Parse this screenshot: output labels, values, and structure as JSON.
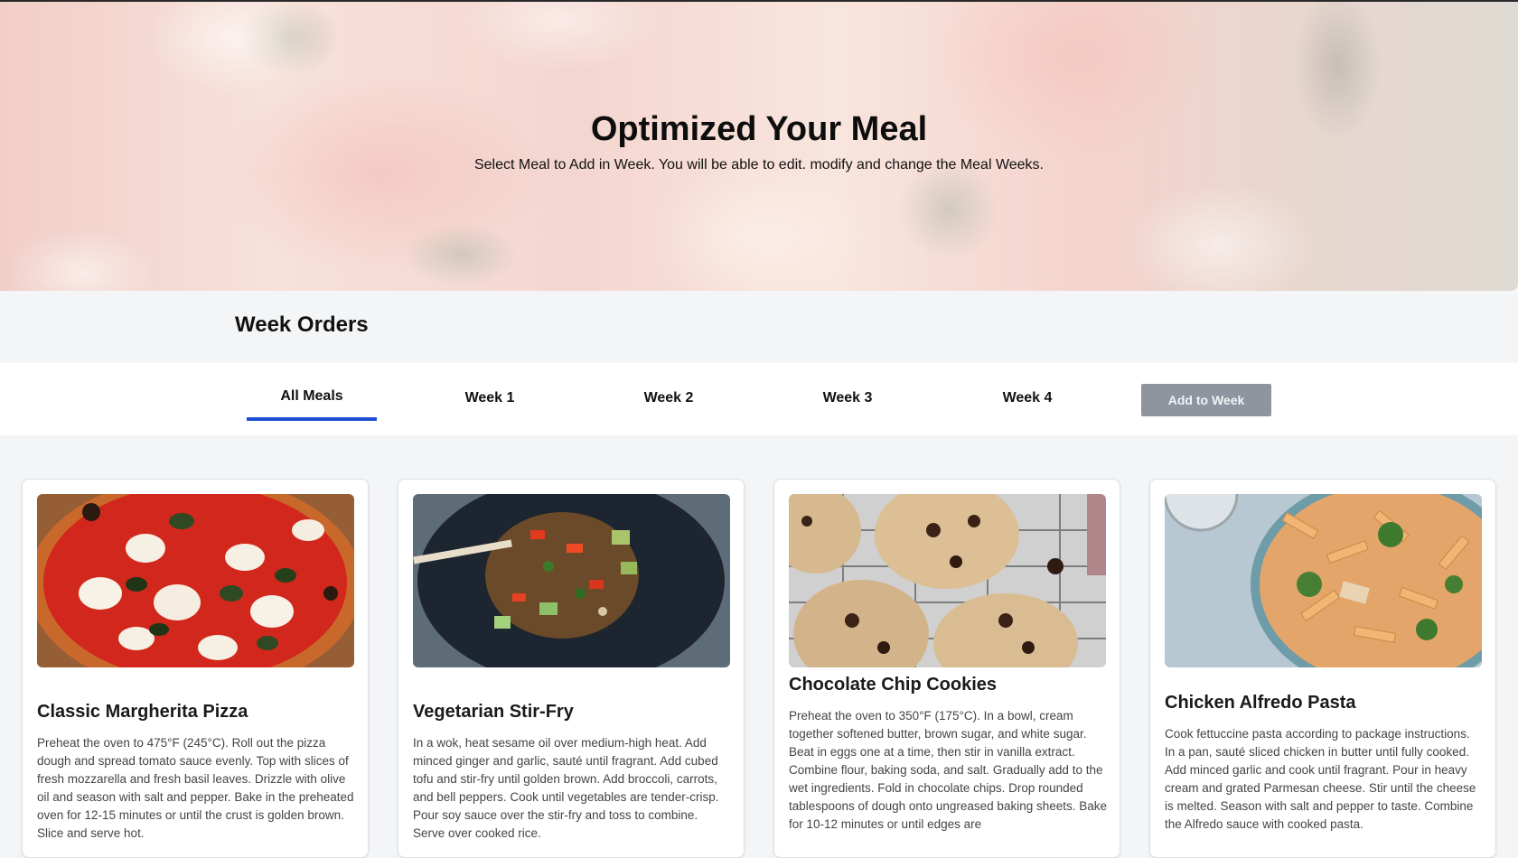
{
  "hero": {
    "title": "Optimized Your Meal",
    "subtitle": "Select Meal to Add in Week. You will be able to edit. modify and change the Meal Weeks."
  },
  "week_orders": {
    "title": "Week Orders"
  },
  "tabs": [
    {
      "label": "All Meals",
      "active": true
    },
    {
      "label": "Week 1",
      "active": false
    },
    {
      "label": "Week 2",
      "active": false
    },
    {
      "label": "Week 3",
      "active": false
    },
    {
      "label": "Week 4",
      "active": false
    }
  ],
  "add_to_week_label": "Add to Week",
  "colors": {
    "accent": "#1f4fd1",
    "button_disabled": "#8e959f"
  },
  "meals": [
    {
      "title": "Classic Margherita Pizza",
      "description": "Preheat the oven to 475°F (245°C). Roll out the pizza dough and spread tomato sauce evenly. Top with slices of fresh mozzarella and fresh basil leaves. Drizzle with olive oil and season with salt and pepper. Bake in the preheated oven for 12-15 minutes or until the crust is golden brown. Slice and serve hot.",
      "image": "margherita-pizza-photo"
    },
    {
      "title": "Vegetarian Stir-Fry",
      "description": "In a wok, heat sesame oil over medium-high heat. Add minced ginger and garlic, sauté until fragrant. Add cubed tofu and stir-fry until golden brown. Add broccoli, carrots, and bell peppers. Cook until vegetables are tender-crisp. Pour soy sauce over the stir-fry and toss to combine. Serve over cooked rice.",
      "image": "stir-fry-photo"
    },
    {
      "title": "Chocolate Chip Cookies",
      "description": "Preheat the oven to 350°F (175°C). In a bowl, cream together softened butter, brown sugar, and white sugar. Beat in eggs one at a time, then stir in vanilla extract. Combine flour, baking soda, and salt. Gradually add to the wet ingredients. Fold in chocolate chips. Drop rounded tablespoons of dough onto ungreased baking sheets. Bake for 10-12 minutes or until edges are",
      "image": "chocolate-chip-cookies-photo"
    },
    {
      "title": "Chicken Alfredo Pasta",
      "description": "Cook fettuccine pasta according to package instructions. In a pan, sauté sliced chicken in butter until fully cooked. Add minced garlic and cook until fragrant. Pour in heavy cream and grated Parmesan cheese. Stir until the cheese is melted. Season with salt and pepper to taste. Combine the Alfredo sauce with cooked pasta.",
      "image": "chicken-alfredo-pasta-photo"
    }
  ]
}
